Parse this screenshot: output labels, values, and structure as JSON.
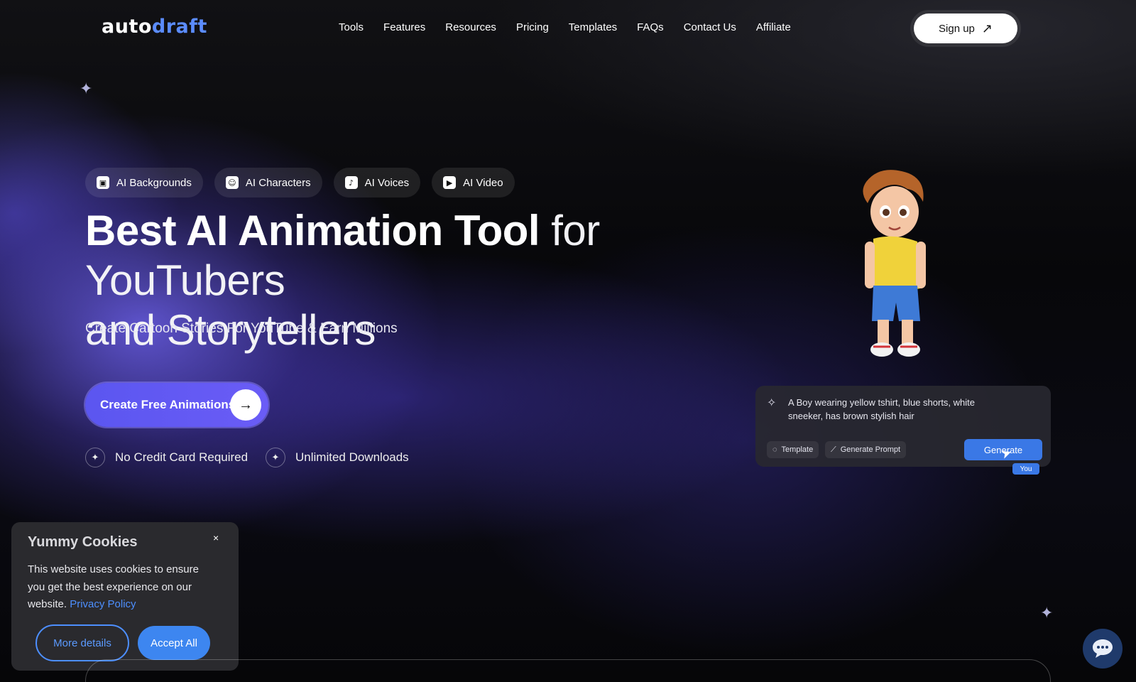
{
  "brand": {
    "logo_part1": "auto",
    "logo_part2": "draft"
  },
  "nav": {
    "items": [
      "Tools",
      "Features",
      "Resources",
      "Pricing",
      "Templates",
      "FAQs",
      "Contact Us",
      "Affiliate"
    ],
    "signup_label": "Sign up"
  },
  "pills": [
    "AI Backgrounds",
    "AI Characters",
    "AI Voices",
    "AI Video"
  ],
  "hero": {
    "title_strong": "Best AI Animation Tool",
    "title_light_1": " for YouTubers",
    "title_light_2": "and Storytellers",
    "subtitle": "Create Cartoon Stories For YouTube & Earn Millions",
    "cta_label": "Create Free Animations",
    "features": [
      "No Credit Card Required",
      "Unlimited Downloads"
    ]
  },
  "prompt": {
    "text": "A Boy wearing yellow tshirt, blue shorts, white sneeker, has brown stylish hair",
    "template_label": "Template",
    "generate_prompt_label": "Generate Prompt",
    "generate_label": "Generate",
    "cursor_tag": "You"
  },
  "cookies": {
    "title": "Yummy Cookies",
    "close": "×",
    "text": "This website uses cookies to ensure you get the best experience on our website.",
    "privacy_link": "Privacy Policy",
    "more_details": "More details",
    "accept_all": "Accept All"
  },
  "colors": {
    "accent": "#5b8cff",
    "cta": "#5b56f0",
    "button_blue": "#3d86f0"
  },
  "icons": [
    "arrow-up-right-icon",
    "image-icon",
    "character-icon",
    "music-icon",
    "video-icon",
    "arrow-right-icon",
    "sparkle-icon",
    "chat-icon"
  ]
}
